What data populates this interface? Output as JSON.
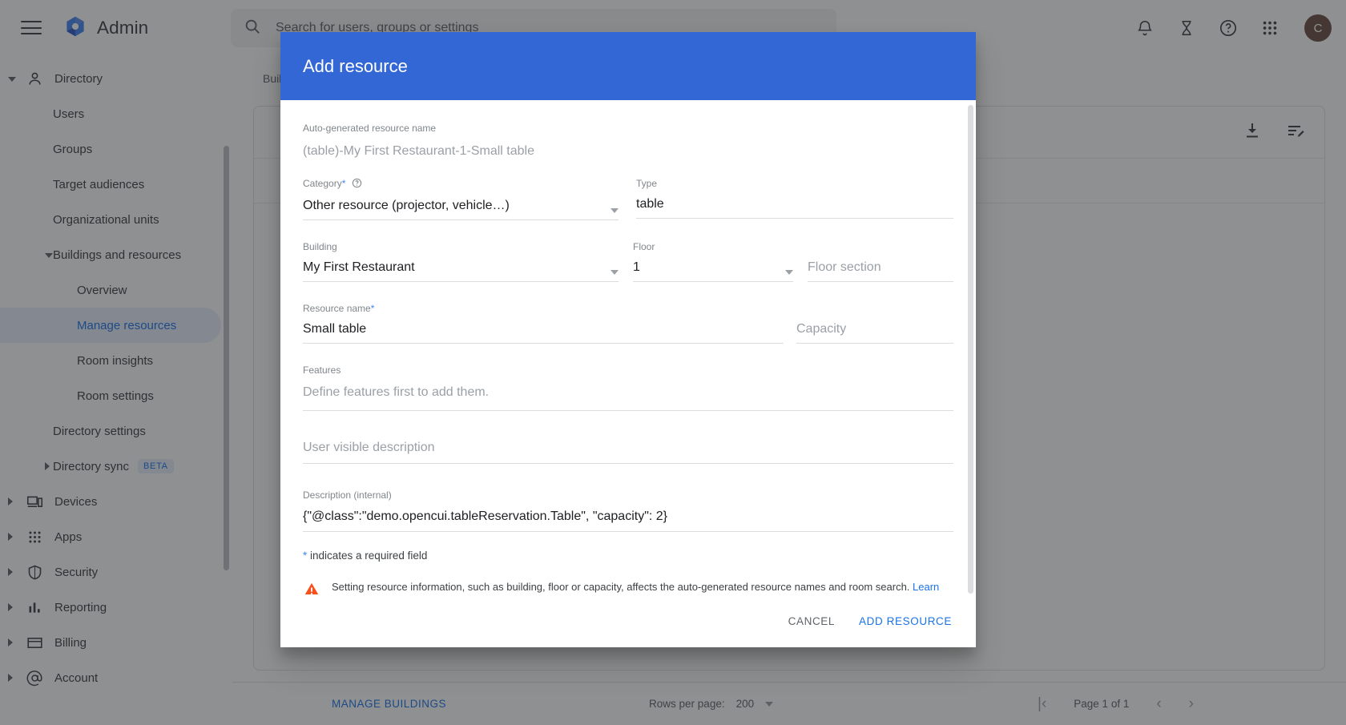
{
  "topbar": {
    "menu_icon": "hamburger-menu-icon",
    "logo_icon": "google-admin-logo-icon",
    "title": "Admin",
    "search": {
      "icon": "search-icon",
      "placeholder": "Search for users, groups or settings",
      "value": ""
    },
    "icons": [
      {
        "name": "notifications-bell-icon",
        "glyph": "bell"
      },
      {
        "name": "hourglass-icon",
        "glyph": "hourglass"
      },
      {
        "name": "help-question-icon",
        "glyph": "question"
      },
      {
        "name": "apps-grid-icon",
        "glyph": "grid"
      }
    ],
    "avatar_initial": "C"
  },
  "sidebar": {
    "scrollbar": "sidebar-scrollbar",
    "items": [
      {
        "label": "Directory",
        "icon": "person-icon",
        "expander": "down",
        "indent": 68,
        "level": 0
      },
      {
        "label": "Users",
        "icon": "",
        "expander": "",
        "indent": 66,
        "level": 1
      },
      {
        "label": "Groups",
        "icon": "",
        "expander": "",
        "indent": 66,
        "level": 1
      },
      {
        "label": "Target audiences",
        "icon": "",
        "expander": "",
        "indent": 66,
        "level": 1
      },
      {
        "label": "Organizational units",
        "icon": "",
        "expander": "",
        "indent": 66,
        "level": 1
      },
      {
        "label": "Buildings and resources",
        "icon": "",
        "expander": "down",
        "indent": 66,
        "level": 1
      },
      {
        "label": "Overview",
        "icon": "",
        "expander": "",
        "indent": 96,
        "level": 2
      },
      {
        "label": "Manage resources",
        "icon": "",
        "expander": "",
        "indent": 96,
        "level": 2,
        "selected": true
      },
      {
        "label": "Room insights",
        "icon": "",
        "expander": "",
        "indent": 96,
        "level": 2
      },
      {
        "label": "Room settings",
        "icon": "",
        "expander": "",
        "indent": 96,
        "level": 2
      },
      {
        "label": "Directory settings",
        "icon": "",
        "expander": "",
        "indent": 66,
        "level": 1
      },
      {
        "label": "Directory sync",
        "icon": "",
        "expander": "right",
        "indent": 66,
        "level": 1,
        "badge": "BETA"
      },
      {
        "label": "Devices",
        "icon": "devices-icon",
        "expander": "right",
        "indent": 68,
        "level": 0
      },
      {
        "label": "Apps",
        "icon": "apps-grid-icon",
        "expander": "right",
        "indent": 68,
        "level": 0
      },
      {
        "label": "Security",
        "icon": "shield-icon",
        "expander": "right",
        "indent": 68,
        "level": 0
      },
      {
        "label": "Reporting",
        "icon": "bar-chart-icon",
        "expander": "right",
        "indent": 68,
        "level": 0
      },
      {
        "label": "Billing",
        "icon": "credit-card-icon",
        "expander": "right",
        "indent": 68,
        "level": 0
      },
      {
        "label": "Account",
        "icon": "at-sign-icon",
        "expander": "right",
        "indent": 68,
        "level": 0
      }
    ]
  },
  "content": {
    "tab_label": "Buildings",
    "toolbar_icons": [
      {
        "name": "download-icon"
      },
      {
        "name": "edit-list-icon"
      }
    ],
    "bottom_bar": {
      "manage_buildings_label": "MANAGE BUILDINGS",
      "rows_per_page_label": "Rows per page:",
      "rows_per_page_value": "200",
      "page_label": "Page 1 of 1",
      "first_page_icon": "first-page-icon",
      "prev_page_icon": "previous-page-icon",
      "next_page_icon": "next-page-icon"
    }
  },
  "dialog": {
    "title": "Add resource",
    "fields": {
      "auto_name": {
        "label": "Auto-generated resource name",
        "value": "(table)-My First Restaurant-1-Small table"
      },
      "category": {
        "label": "Category",
        "required_star": "*",
        "help_icon": "help-circle-icon",
        "value": "Other resource (projector, vehicle…)",
        "dropdown_icon": "chevron-down-icon"
      },
      "type": {
        "label": "Type",
        "value": "table"
      },
      "building": {
        "label": "Building",
        "value": "My First Restaurant",
        "dropdown_icon": "chevron-down-icon"
      },
      "floor": {
        "label": "Floor",
        "value": "1",
        "dropdown_icon": "chevron-down-icon"
      },
      "floor_section": {
        "label": "",
        "placeholder": "Floor section",
        "value": ""
      },
      "resource_name": {
        "label": "Resource name",
        "required_star": "*",
        "value": "Small table"
      },
      "capacity": {
        "label": "",
        "placeholder": "Capacity",
        "value": ""
      },
      "features": {
        "label": "Features",
        "empty_text": "Define features first to add them."
      },
      "user_visible_description": {
        "placeholder": "User visible description",
        "value": ""
      },
      "internal_description": {
        "label": "Description (internal)",
        "value": "{\"@class\":\"demo.opencui.tableReservation.Table\", \"capacity\": 2}"
      }
    },
    "required_note": {
      "star": "*",
      "text": " indicates a required field"
    },
    "warning": {
      "icon": "warning-triangle-icon",
      "text": "Setting resource information, such as building, floor or capacity, affects the auto-generated resource names and room search. ",
      "link_text": "Learn more."
    },
    "footer": {
      "cancel_label": "CANCEL",
      "submit_label": "ADD RESOURCE"
    }
  },
  "colors": {
    "accent_blue": "#1a73e8",
    "dialog_header_blue": "#3367d6",
    "warning_orange": "#f4511e",
    "selected_nav_bg": "#e8f0fe"
  }
}
